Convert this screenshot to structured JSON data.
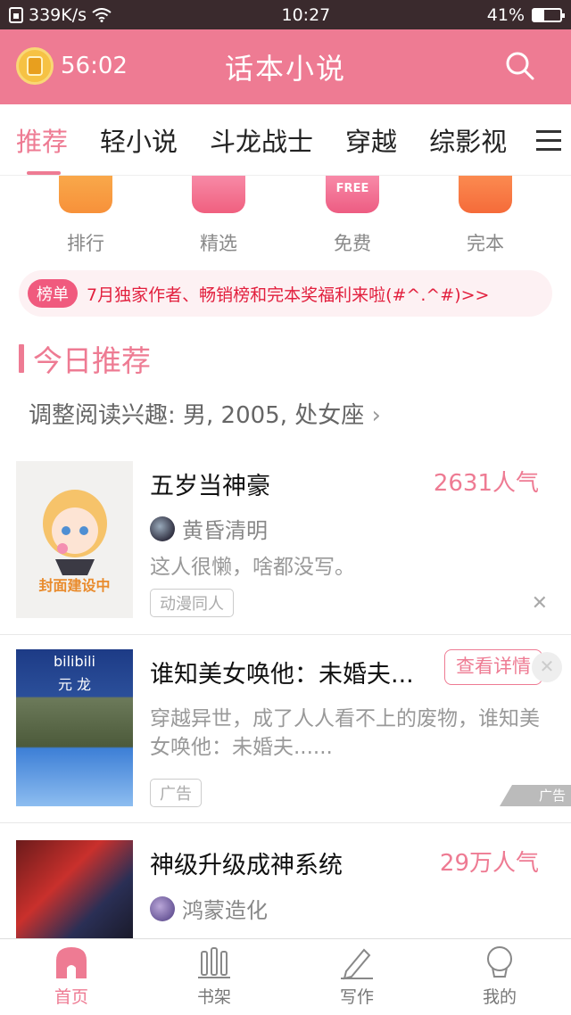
{
  "status_bar": {
    "speed": "339K/s",
    "time": "10:27",
    "battery": "41%",
    "battery_level": 0.41
  },
  "header": {
    "timer": "56:02",
    "title": "话本小说"
  },
  "tabs": [
    {
      "label": "推荐",
      "active": true
    },
    {
      "label": "轻小说"
    },
    {
      "label": "斗龙战士"
    },
    {
      "label": "穿越"
    },
    {
      "label": "综影视"
    }
  ],
  "quick_entries": [
    {
      "label": "排行",
      "icon": "trophy-icon"
    },
    {
      "label": "精选",
      "icon": "star-icon"
    },
    {
      "label": "免费",
      "icon": "free-icon",
      "icon_text": "FREE"
    },
    {
      "label": "完本",
      "icon": "check-book-icon"
    }
  ],
  "notice": {
    "badge": "榜单",
    "text": "7月独家作者、畅销榜和完本奖福利来啦(#^.^#)>>"
  },
  "section": {
    "title": "今日推荐",
    "interest": "调整阅读兴趣: 男, 2005, 处女座 ",
    "interest_arrow": "›"
  },
  "books": [
    {
      "title": "五岁当神豪",
      "popularity": "2631人气",
      "author": "黄昏清明",
      "description": "这人很懒，啥都没写。",
      "tag": "动漫同人",
      "cover_text": "封面建设中"
    },
    {
      "title": "谁知美女唤他：未婚夫...",
      "button": "查看详情",
      "description": "穿越异世，成了人人看不上的废物，谁知美女唤他：未婚夫......",
      "tag": "广告",
      "ad_mark": "广告",
      "cover_text_1": "bilibili",
      "cover_text_2": "元 龙"
    },
    {
      "title": "神级升级成神系统",
      "popularity": "29万人气",
      "author": "鸿蒙造化"
    }
  ],
  "bottom_nav": [
    {
      "label": "首页",
      "icon": "home-icon",
      "active": true
    },
    {
      "label": "书架",
      "icon": "bookshelf-icon"
    },
    {
      "label": "写作",
      "icon": "pen-icon"
    },
    {
      "label": "我的",
      "icon": "profile-icon"
    }
  ],
  "colors": {
    "accent": "#ee7b93",
    "status_bar": "#3a2a2d",
    "notice_text": "#e2203e"
  }
}
